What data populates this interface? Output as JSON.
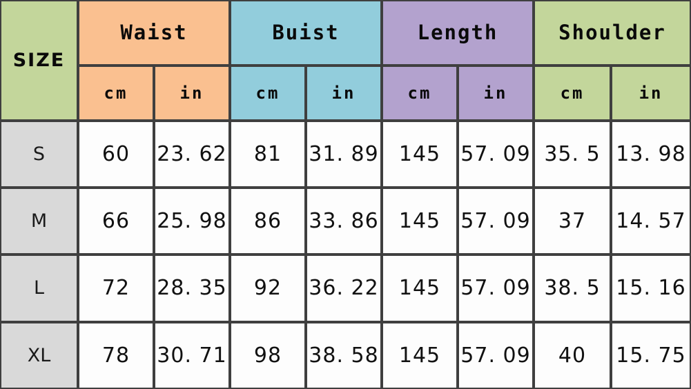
{
  "table": {
    "size_header": "SIZE",
    "groups": [
      {
        "label": "Waist",
        "color": "#fac090",
        "units": [
          "cm",
          "in"
        ]
      },
      {
        "label": "Buist",
        "color": "#92cddc",
        "units": [
          "cm",
          "in"
        ]
      },
      {
        "label": "Length",
        "color": "#b3a2ce",
        "units": [
          "cm",
          "in"
        ]
      },
      {
        "label": "Shoulder",
        "color": "#c3d69b",
        "units": [
          "cm",
          "in"
        ]
      }
    ],
    "columns": [
      "SIZE",
      "Waist cm",
      "Waist in",
      "Buist cm",
      "Buist in",
      "Length cm",
      "Length in",
      "Shoulder cm",
      "Shoulder in"
    ],
    "rows": [
      {
        "size": "S",
        "values": [
          "60",
          "23. 62",
          "81",
          "31. 89",
          "145",
          "57. 09",
          "35. 5",
          "13. 98"
        ]
      },
      {
        "size": "M",
        "values": [
          "66",
          "25. 98",
          "86",
          "33. 86",
          "145",
          "57. 09",
          "37",
          "14. 57"
        ]
      },
      {
        "size": "L",
        "values": [
          "72",
          "28. 35",
          "92",
          "36. 22",
          "145",
          "57. 09",
          "38. 5",
          "15. 16"
        ]
      },
      {
        "size": "XL",
        "values": [
          "78",
          "30. 71",
          "98",
          "38. 58",
          "145",
          "57. 09",
          "40",
          "15. 75"
        ]
      }
    ],
    "colors": {
      "size_header_fill": "#c3d69b",
      "size_cell_fill": "#d9d9d9",
      "value_cell_fill": "#fdfdfd",
      "border": "#3f3f3f",
      "text": "#111111"
    }
  }
}
